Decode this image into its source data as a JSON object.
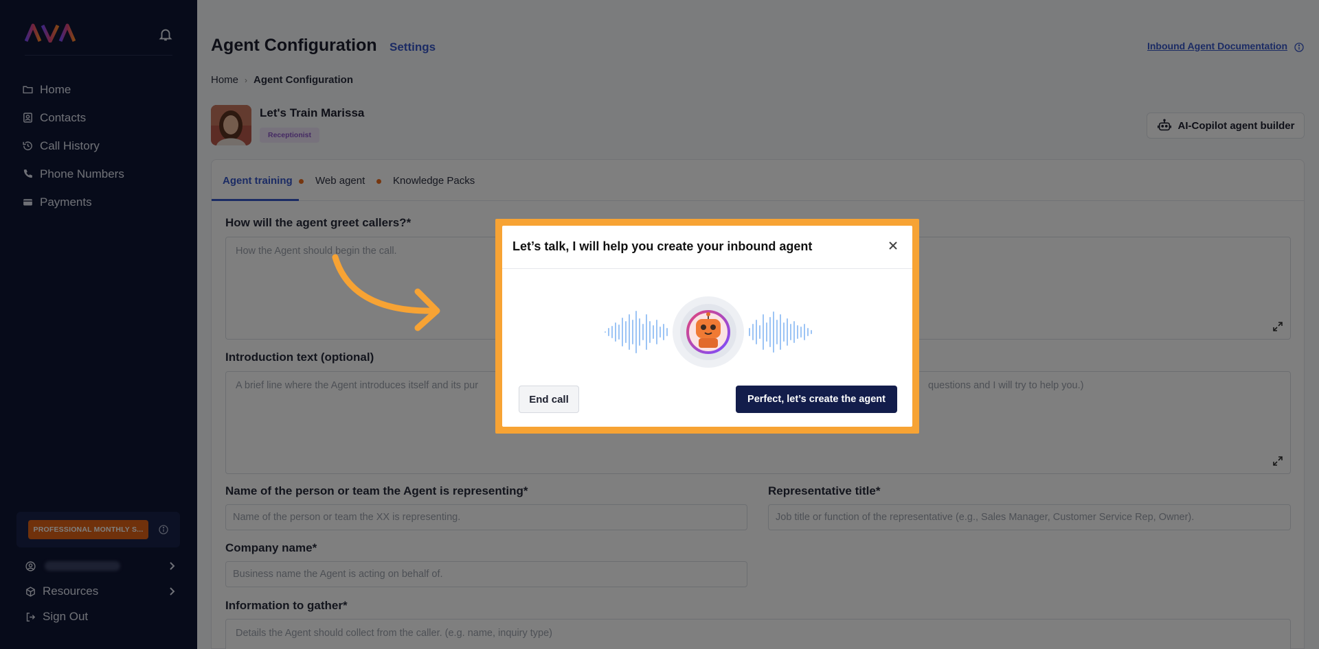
{
  "sidebar": {
    "nav": [
      {
        "label": "Home",
        "icon": "folder-icon"
      },
      {
        "label": "Contacts",
        "icon": "contacts-icon"
      },
      {
        "label": "Call History",
        "icon": "history-icon"
      },
      {
        "label": "Phone Numbers",
        "icon": "phone-icon"
      },
      {
        "label": "Payments",
        "icon": "card-icon"
      }
    ],
    "plan_label": "PROFESSIONAL MONTHLY S...",
    "resources_label": "Resources",
    "signout_label": "Sign Out"
  },
  "header": {
    "title": "Agent Configuration",
    "settings_label": "Settings",
    "doc_link": "Inbound Agent Documentation"
  },
  "breadcrumb": {
    "home": "Home",
    "current": "Agent Configuration"
  },
  "agent": {
    "name": "Let's Train Marissa",
    "role": "Receptionist"
  },
  "copilot_label": "AI-Copilot agent builder",
  "tabs": [
    {
      "label": "Agent training",
      "active": true
    },
    {
      "label": "Web agent",
      "active": false
    },
    {
      "label": "Knowledge Packs",
      "active": false
    }
  ],
  "fields": {
    "greet_label": "How will the agent greet callers?*",
    "greet_placeholder": "How the Agent should begin the call.",
    "intro_label": "Introduction text (optional)",
    "intro_placeholder": "A brief line where the Agent introduces itself and its pur",
    "intro_placeholder_tail": "questions and I will try to help you.)",
    "person_label": "Name of the person or team the Agent is representing*",
    "person_placeholder": "Name of the person or team the XX is representing.",
    "rep_label": "Representative title*",
    "rep_placeholder": "Job title or function of the representative (e.g., Sales Manager, Customer Service Rep, Owner).",
    "company_label": "Company name*",
    "company_placeholder": "Business name the Agent is acting on behalf of.",
    "info_label": "Information to gather*",
    "info_placeholder": "Details the Agent should collect from the caller. (e.g. name, inquiry type)"
  },
  "modal": {
    "title": "Let’s talk, I will help you create your inbound agent",
    "end_call": "End call",
    "create": "Perfect, let’s create the agent"
  },
  "colors": {
    "sidebar_bg": "#0f1634",
    "accent": "#3657c9",
    "highlight": "#f7a334",
    "primary_button": "#131d4b",
    "plan_badge": "#e06216"
  }
}
